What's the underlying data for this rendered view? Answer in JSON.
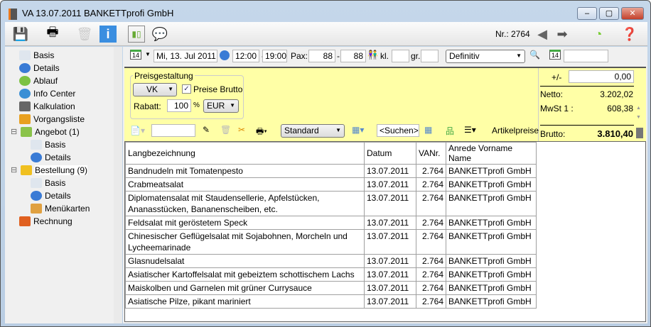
{
  "window": {
    "title": "VA 13.07.2011 BANKETTprofi GmbH",
    "minimize": "–",
    "maximize": "▢",
    "close": "✕"
  },
  "toolbar": {
    "nr_label": "Nr.: 2764"
  },
  "sidebar": {
    "items": [
      {
        "label": "Basis",
        "icon": "basis-icon",
        "indent": 1,
        "color": "#dfe6ee"
      },
      {
        "label": "Details",
        "icon": "info-icon",
        "indent": 1,
        "color": "#3a7bd5"
      },
      {
        "label": "Ablauf",
        "icon": "clock-icon",
        "indent": 1,
        "color": "#7cc242"
      },
      {
        "label": "Info Center",
        "icon": "globe-icon",
        "indent": 1,
        "color": "#3a8fd5"
      },
      {
        "label": "Kalkulation",
        "icon": "calculator-icon",
        "indent": 1,
        "color": "#666"
      },
      {
        "label": "Vorgangsliste",
        "icon": "list-icon",
        "indent": 1,
        "color": "#e8a020"
      },
      {
        "label": "Angebot (1)",
        "icon": "puzzle-icon",
        "indent": 0,
        "color": "#8bc34a"
      },
      {
        "label": "Basis",
        "icon": "basis-icon",
        "indent": 2,
        "color": "#dfe6ee"
      },
      {
        "label": "Details",
        "icon": "info-icon",
        "indent": 2,
        "color": "#3a7bd5"
      },
      {
        "label": "Bestellung (9)",
        "icon": "puzzle-icon",
        "indent": 0,
        "color": "#f0c020"
      },
      {
        "label": "Basis",
        "icon": "basis-icon",
        "indent": 2,
        "color": "#dfe6ee"
      },
      {
        "label": "Details",
        "icon": "info-icon",
        "indent": 2,
        "color": "#3a7bd5"
      },
      {
        "label": "Menükarten",
        "icon": "menu-card-icon",
        "indent": 2,
        "color": "#e0a040"
      },
      {
        "label": "Rechnung",
        "icon": "invoice-icon",
        "indent": 1,
        "color": "#e06020"
      }
    ]
  },
  "header": {
    "date": "Mi, 13. Jul 2011",
    "time_from": "12:00",
    "dash": "-",
    "time_to": "19:00",
    "pax_label": "Pax:",
    "pax_from": "88",
    "pax_to": "88",
    "kl_label": "kl.",
    "gr_label": "gr.",
    "status": "Definitiv",
    "calendar_day": "14"
  },
  "pricing": {
    "group_label": "Preisgestaltung",
    "price_type": "VK",
    "brutto_label": "Preise Brutto",
    "rabatt_label": "Rabatt:",
    "rabatt_value": "100",
    "percent": "%",
    "currency": "EUR"
  },
  "totals": {
    "plusminus_label": "+/-",
    "plusminus_value": "0,00",
    "netto_label": "Netto:",
    "netto_value": "3.202,02",
    "mwst_label": "MwSt 1 :",
    "mwst_value": "608,38",
    "brutto_label": "Brutto:",
    "brutto_value": "3.810,40"
  },
  "listbar": {
    "view": "Standard",
    "search": "<Suchen>",
    "artikelpreise": "Artikelpreise"
  },
  "table": {
    "columns": [
      "Langbezeichnung",
      "Datum",
      "VANr.",
      "Anrede Vorname Name"
    ],
    "rows": [
      [
        "Bandnudeln mit Tomatenpesto",
        "13.07.2011",
        "2.764",
        "BANKETTprofi GmbH"
      ],
      [
        "Crabmeatsalat",
        "13.07.2011",
        "2.764",
        "BANKETTprofi GmbH"
      ],
      [
        "Diplomatensalat mit Staudensellerie, Apfelstücken, Ananasstücken, Bananenscheiben, etc.",
        "13.07.2011",
        "2.764",
        "BANKETTprofi GmbH"
      ],
      [
        "Feldsalat mit geröstetem Speck",
        "13.07.2011",
        "2.764",
        "BANKETTprofi GmbH"
      ],
      [
        "Chinesischer Geflügelsalat mit Sojabohnen, Morcheln und Lycheemarinade",
        "13.07.2011",
        "2.764",
        "BANKETTprofi GmbH"
      ],
      [
        "Glasnudelsalat",
        "13.07.2011",
        "2.764",
        "BANKETTprofi GmbH"
      ],
      [
        "Asiatischer Kartoffelsalat mit gebeiztem schottischem Lachs",
        "13.07.2011",
        "2.764",
        "BANKETTprofi GmbH"
      ],
      [
        "Maiskolben und Garnelen mit grüner Currysauce",
        "13.07.2011",
        "2.764",
        "BANKETTprofi GmbH"
      ],
      [
        "Asiatische Pilze, pikant mariniert",
        "13.07.2011",
        "2.764",
        "BANKETTprofi GmbH"
      ]
    ]
  }
}
